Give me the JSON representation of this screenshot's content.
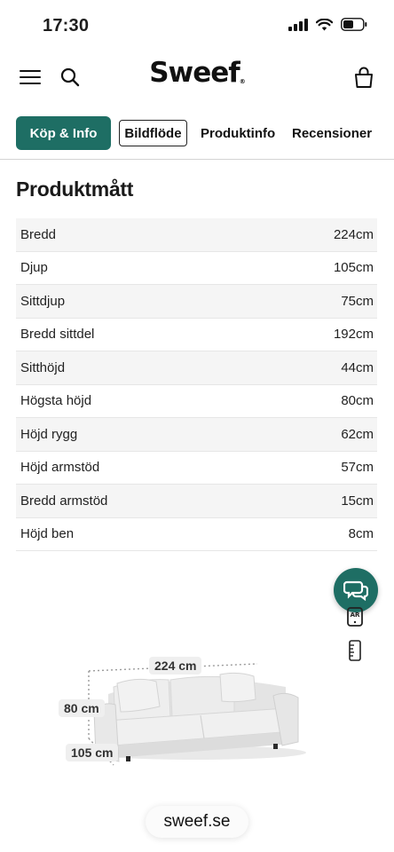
{
  "status_bar": {
    "time": "17:30",
    "icons": [
      "signal-icon",
      "wifi-icon",
      "battery-icon"
    ]
  },
  "header": {
    "logo_text": "Sweef",
    "icons": [
      "hamburger-menu-icon",
      "search-icon",
      "shopping-bag-icon"
    ]
  },
  "tabs": [
    {
      "label": "Köp & Info",
      "style": "filled"
    },
    {
      "label": "Bildflöde",
      "style": "outlined"
    },
    {
      "label": "Produktinfo",
      "style": "text"
    },
    {
      "label": "Recensioner",
      "style": "text"
    }
  ],
  "section": {
    "title": "Produktmått"
  },
  "dimensions": [
    {
      "label": "Bredd",
      "value": "224cm"
    },
    {
      "label": "Djup",
      "value": "105cm"
    },
    {
      "label": "Sittdjup",
      "value": "75cm"
    },
    {
      "label": "Bredd sittdel",
      "value": "192cm"
    },
    {
      "label": "Sitthöjd",
      "value": "44cm"
    },
    {
      "label": "Högsta höjd",
      "value": "80cm"
    },
    {
      "label": "Höjd rygg",
      "value": "62cm"
    },
    {
      "label": "Höjd armstöd",
      "value": "57cm"
    },
    {
      "label": "Bredd armstöd",
      "value": "15cm"
    },
    {
      "label": "Höjd ben",
      "value": "8cm"
    }
  ],
  "floating": {
    "icons": [
      "chat-icon",
      "ar-icon",
      "ruler-icon"
    ]
  },
  "illustration": {
    "width_label": "224 cm",
    "height_label": "80 cm",
    "depth_label": "105 cm"
  },
  "url_bar": {
    "domain": "sweef.se"
  },
  "colors": {
    "brand": "#1e6e64",
    "row_alt": "#f5f5f5",
    "divider": "#e6e6e6"
  }
}
